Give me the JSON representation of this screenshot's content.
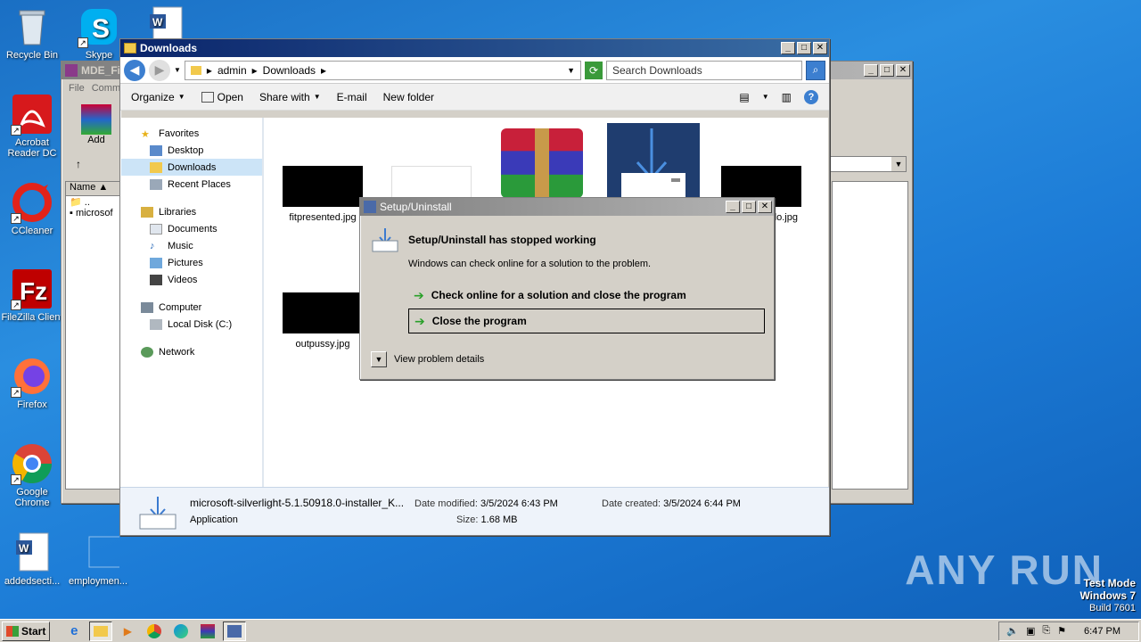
{
  "desktop": {
    "icons": [
      {
        "label": "Recycle Bin"
      },
      {
        "label": "Skype"
      },
      {
        "label": "Acrobat Reader DC"
      },
      {
        "label": "CCleaner"
      },
      {
        "label": "FileZilla Client"
      },
      {
        "label": "Firefox"
      },
      {
        "label": "Google Chrome"
      },
      {
        "label": "addedsecti..."
      },
      {
        "label": "employmen..."
      }
    ]
  },
  "watermark": {
    "text": "ANY RUN"
  },
  "testmode": {
    "line1": "Test Mode",
    "line2": "Windows 7",
    "line3": "Build 7601"
  },
  "bg_window": {
    "title": "MDE_Fil",
    "menu_file": "File",
    "menu_comm": "Comm",
    "add_label": "Add",
    "col_name": "Name",
    "row1": "..",
    "row2": "microsof"
  },
  "explorer": {
    "title": "Downloads",
    "breadcrumb": [
      "admin",
      "Downloads"
    ],
    "search_placeholder": "Search Downloads",
    "toolbar": {
      "organize": "Organize",
      "open": "Open",
      "share": "Share with",
      "email": "E-mail",
      "newfolder": "New folder"
    },
    "nav": {
      "favorites": "Favorites",
      "desktop": "Desktop",
      "downloads": "Downloads",
      "recent": "Recent Places",
      "libraries": "Libraries",
      "documents": "Documents",
      "music": "Music",
      "pictures": "Pictures",
      "videos": "Videos",
      "computer": "Computer",
      "localdisk": "Local Disk (C:)",
      "network": "Network"
    },
    "files": [
      {
        "name": "fitpresented.jpg"
      },
      {
        "name": "outpussy.jpg"
      },
      {
        "name": "do.jpg"
      }
    ],
    "details": {
      "filename": "microsoft-silverlight-5.1.50918.0-installer_K...",
      "type": "Application",
      "modified_label": "Date modified:",
      "modified": "3/5/2024 6:43 PM",
      "created_label": "Date created:",
      "created": "3/5/2024 6:44 PM",
      "size_label": "Size:",
      "size": "1.68 MB"
    }
  },
  "dialog": {
    "title": "Setup/Uninstall",
    "heading": "Setup/Uninstall has stopped working",
    "message": "Windows can check online for a solution to the problem.",
    "option1": "Check online for a solution and close the program",
    "option2": "Close the program",
    "details": "View problem details"
  },
  "taskbar": {
    "start": "Start",
    "time": "6:47 PM"
  },
  "colors": {
    "accent": "#0a246a",
    "desktop": "#1c7bd6"
  }
}
